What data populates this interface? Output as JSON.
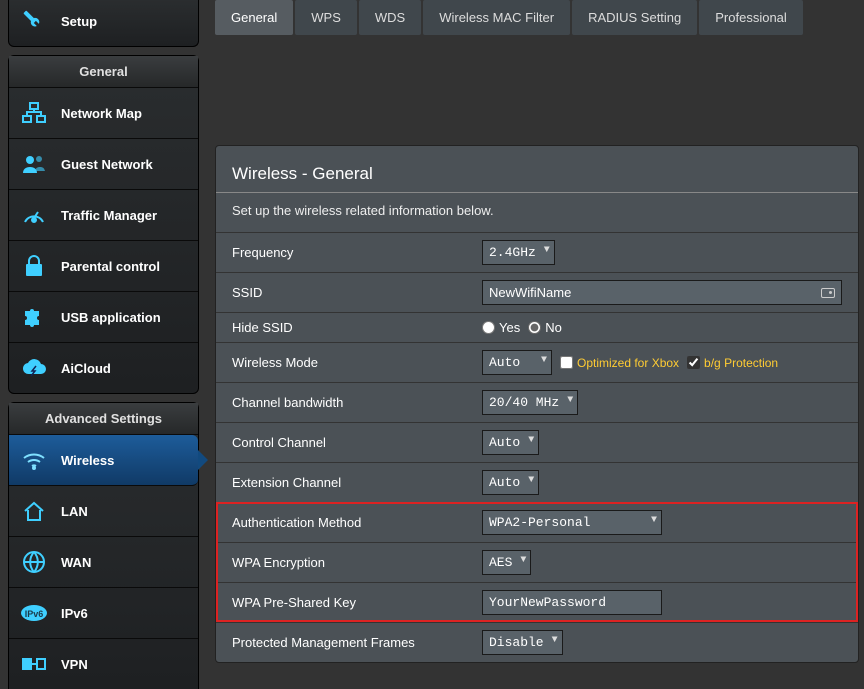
{
  "sidebar": {
    "top": {
      "label": "Setup"
    },
    "general_header": "General",
    "general_items": [
      {
        "label": "Network Map"
      },
      {
        "label": "Guest Network"
      },
      {
        "label": "Traffic Manager"
      },
      {
        "label": "Parental control"
      },
      {
        "label": "USB application"
      },
      {
        "label": "AiCloud"
      }
    ],
    "advanced_header": "Advanced Settings",
    "advanced_items": [
      {
        "label": "Wireless"
      },
      {
        "label": "LAN"
      },
      {
        "label": "WAN"
      },
      {
        "label": "IPv6"
      },
      {
        "label": "VPN"
      }
    ]
  },
  "tabs": [
    {
      "label": "General"
    },
    {
      "label": "WPS"
    },
    {
      "label": "WDS"
    },
    {
      "label": "Wireless MAC Filter"
    },
    {
      "label": "RADIUS Setting"
    },
    {
      "label": "Professional"
    }
  ],
  "panel": {
    "title": "Wireless - General",
    "desc": "Set up the wireless related information below.",
    "rows": {
      "frequency": {
        "label": "Frequency",
        "value": "2.4GHz"
      },
      "ssid": {
        "label": "SSID",
        "value": "NewWifiName"
      },
      "hide_ssid": {
        "label": "Hide SSID",
        "yes": "Yes",
        "no": "No"
      },
      "wireless_mode": {
        "label": "Wireless Mode",
        "value": "Auto",
        "xbox": "Optimized for Xbox",
        "bg": "b/g Protection"
      },
      "channel_bw": {
        "label": "Channel bandwidth",
        "value": "20/40 MHz"
      },
      "control_ch": {
        "label": "Control Channel",
        "value": "Auto"
      },
      "ext_ch": {
        "label": "Extension Channel",
        "value": "Auto"
      },
      "auth": {
        "label": "Authentication Method",
        "value": "WPA2-Personal"
      },
      "wpa_enc": {
        "label": "WPA Encryption",
        "value": "AES"
      },
      "psk": {
        "label": "WPA Pre-Shared Key",
        "value": "YourNewPassword"
      },
      "pmf": {
        "label": "Protected Management Frames",
        "value": "Disable"
      }
    }
  }
}
